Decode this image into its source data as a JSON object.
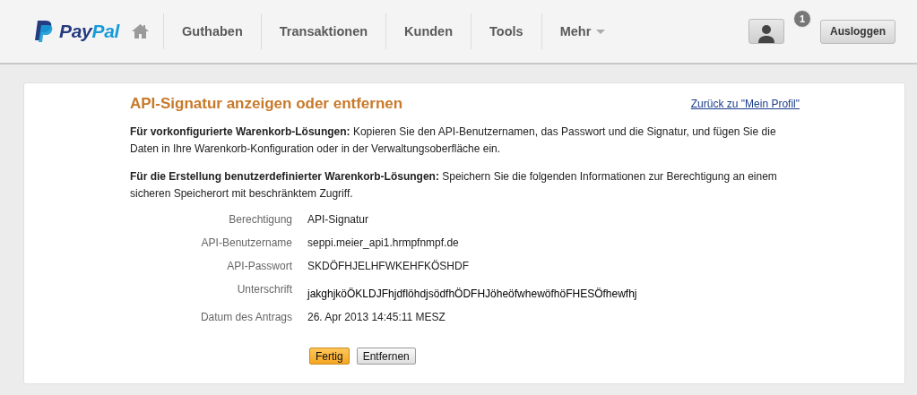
{
  "header": {
    "logo": [
      "Pay",
      "Pal"
    ],
    "nav": [
      {
        "label": "Guthaben",
        "kind": "link"
      },
      {
        "label": "Transaktionen",
        "kind": "link"
      },
      {
        "label": "Kunden",
        "kind": "link"
      },
      {
        "label": "Tools",
        "kind": "link"
      },
      {
        "label": "Mehr",
        "kind": "menu"
      }
    ],
    "notification_count": "1",
    "logout": "Ausloggen"
  },
  "panel": {
    "title": "API-Signatur anzeigen oder entfernen",
    "back_link": "Zurück zu \"Mein Profil\"",
    "paragraphs": [
      "**Für vorkonfigurierte Warenkorb-Lösungen:** Kopieren Sie den API-Benutzernamen, das Passwort und die Signatur, und fügen Sie die Daten in Ihre Warenkorb-Konfiguration oder in der Verwaltungsoberfläche ein.",
      "**Für die Erstellung benutzerdefinierter Warenkorb-Lösungen:** Speichern Sie die folgenden Informationen zur Berechtigung an einem sicheren Speicherort mit beschränktem Zugriff."
    ],
    "fields": [
      {
        "label": "Berechtigung",
        "value": "API-Signatur"
      },
      {
        "label": "API-Benutzername",
        "value": "seppi.meier_api1.hrmpfnmpf.de"
      },
      {
        "label": "API-Passwort",
        "value": "SKDÖFHJELHFWKEHFKÖSHDF"
      },
      {
        "label": "Unterschrift",
        "value": "jakghjköÖKLDJFhjdflöhdjsödfhÖDFHJöheöfwhewöfhöFHESÖfhewfhj"
      },
      {
        "label": "Datum des Antrags",
        "value": "26. Apr 2013 14:45:11 MESZ"
      }
    ],
    "buttons": [
      {
        "label": "Fertig",
        "primary": true
      },
      {
        "label": "Entfernen",
        "primary": false
      }
    ]
  }
}
